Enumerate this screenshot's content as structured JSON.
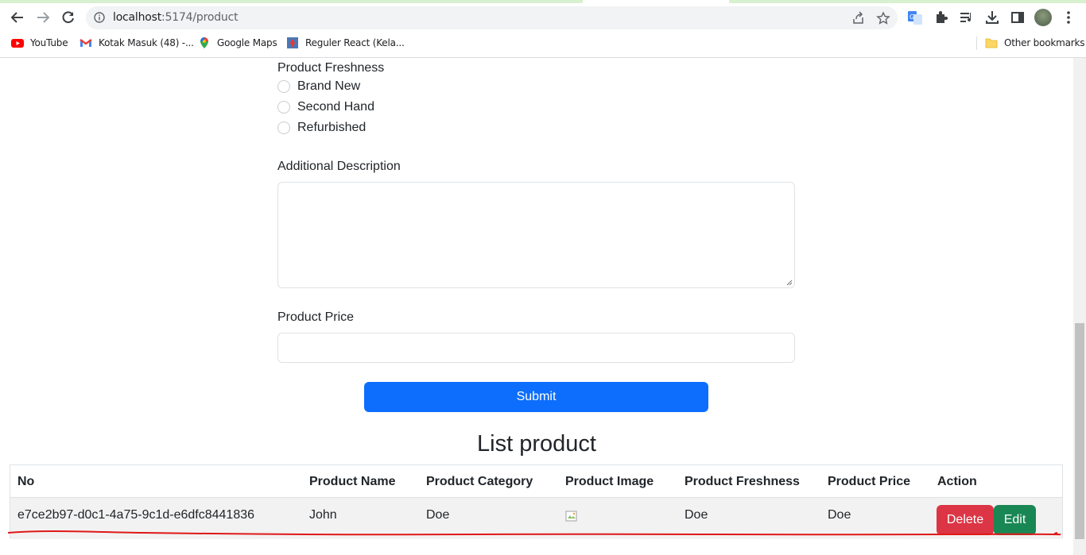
{
  "browser": {
    "url_host": "localhost",
    "url_path": ":5174/product",
    "bookmarks": [
      {
        "label": "YouTube",
        "icon": "youtube-icon"
      },
      {
        "label": "Kotak Masuk (48) -...",
        "icon": "gmail-icon"
      },
      {
        "label": "Google Maps",
        "icon": "maps-pin-icon"
      },
      {
        "label": "Reguler React (Kela...",
        "icon": "bookmark-page-icon"
      }
    ],
    "other_bookmarks": "Other bookmarks"
  },
  "form": {
    "freshness_label": "Product Freshness",
    "freshness_options": [
      "Brand New",
      "Second Hand",
      "Refurbished"
    ],
    "description_label": "Additional Description",
    "description_value": "",
    "price_label": "Product Price",
    "price_value": "",
    "submit_label": "Submit"
  },
  "list": {
    "title": "List product",
    "columns": [
      "No",
      "Product Name",
      "Product Category",
      "Product Image",
      "Product Freshness",
      "Product Price",
      "Action"
    ],
    "rows": [
      {
        "no": "e7ce2b97-d0c1-4a75-9c1d-e6dfc8441836",
        "name": "John",
        "category": "Doe",
        "freshness": "Doe",
        "price": "Doe",
        "delete_label": "Delete",
        "edit_label": "Edit"
      }
    ]
  },
  "colors": {
    "primary": "#0d6efd",
    "danger": "#dc3545",
    "success": "#198754",
    "annotation_red": "#e01818"
  }
}
